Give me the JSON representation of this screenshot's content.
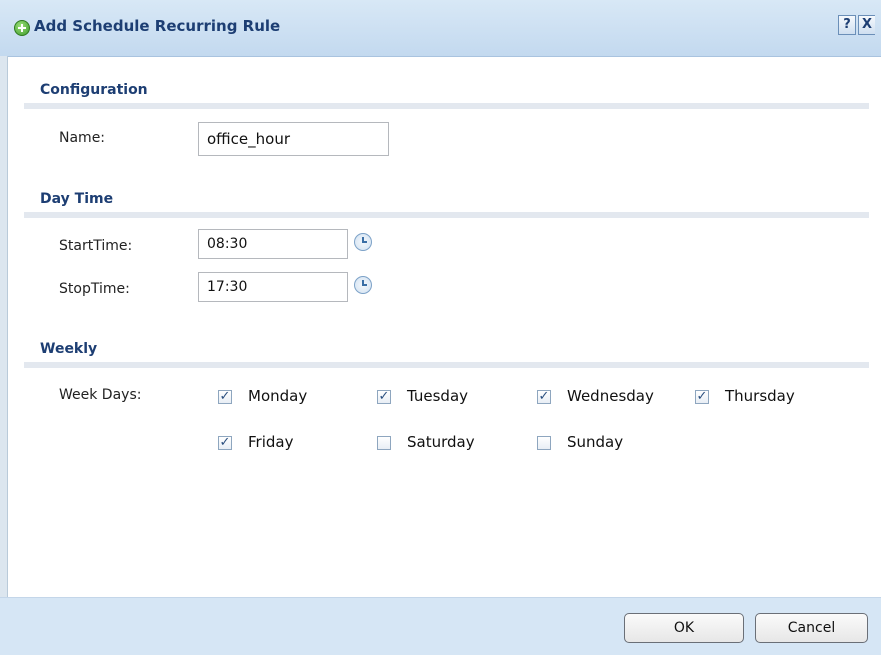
{
  "window": {
    "title": "Add Schedule Recurring Rule",
    "help_label": "?",
    "close_label": "X"
  },
  "configuration": {
    "section_title": "Configuration",
    "name_label": "Name:",
    "name_value": "office_hour"
  },
  "day_time": {
    "section_title": "Day Time",
    "start_label": "StartTime:",
    "start_value": "08:30",
    "stop_label": "StopTime:",
    "stop_value": "17:30"
  },
  "weekly": {
    "section_title": "Weekly",
    "week_days_label": "Week Days:",
    "days": [
      {
        "label": "Monday",
        "checked": true
      },
      {
        "label": "Tuesday",
        "checked": true
      },
      {
        "label": "Wednesday",
        "checked": true
      },
      {
        "label": "Thursday",
        "checked": true
      },
      {
        "label": "Friday",
        "checked": true
      },
      {
        "label": "Saturday",
        "checked": false
      },
      {
        "label": "Sunday",
        "checked": false
      }
    ]
  },
  "buttons": {
    "ok_label": "OK",
    "cancel_label": "Cancel"
  }
}
